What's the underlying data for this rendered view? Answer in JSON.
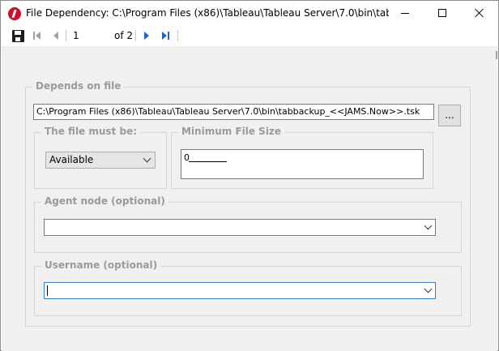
{
  "window": {
    "title": "File Dependency: C:\\Program Files (x86)\\Tableau\\Tableau Server\\7.0\\bin\\tabbacku..."
  },
  "toolbar": {
    "page_value": "1",
    "page_of": "of 2",
    "icons": [
      "save-icon",
      "first-page-icon",
      "previous-page-icon",
      "next-page-icon",
      "last-page-icon"
    ]
  },
  "depends_on_file": {
    "legend": "Depends on file",
    "path_value": "C:\\Program Files (x86)\\Tableau\\Tableau Server\\7.0\\bin\\tabbackup_<<JAMS.Now>>.tsk",
    "browse_label": "..."
  },
  "file_must_be": {
    "legend": "The file must be:",
    "selected": "Available"
  },
  "minimum_file_size": {
    "legend": "Minimum File Size",
    "value": "0"
  },
  "agent_node": {
    "legend": "Agent node (optional)",
    "value": ""
  },
  "username": {
    "legend": "Username (optional)",
    "value": ""
  },
  "colors": {
    "legend_text": "#9a9a9a",
    "client_bg": "#f0f0f0",
    "nav_blue": "#1f64c8",
    "app_icon_red": "#c8102e",
    "focus_border": "#3c7fc1"
  }
}
